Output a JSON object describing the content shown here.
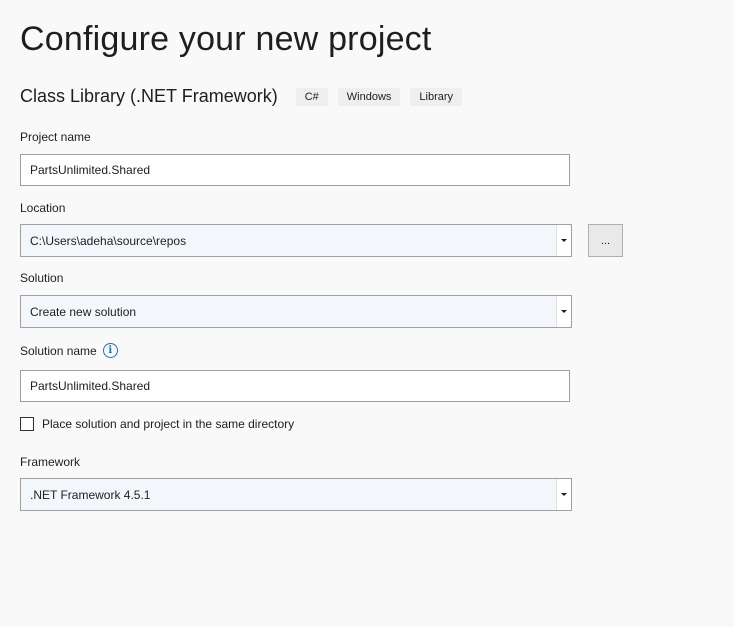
{
  "title": "Configure your new project",
  "template": {
    "name": "Class Library (.NET Framework)",
    "tags": [
      "C#",
      "Windows",
      "Library"
    ]
  },
  "project_name": {
    "label": "Project name",
    "value": "PartsUnlimited.Shared"
  },
  "location": {
    "label": "Location",
    "value": "C:\\Users\\adeha\\source\\repos",
    "browse_label": "..."
  },
  "solution": {
    "label": "Solution",
    "value": "Create new solution"
  },
  "solution_name": {
    "label": "Solution name",
    "value": "PartsUnlimited.Shared",
    "info_glyph": "i"
  },
  "same_directory": {
    "label": "Place solution and project in the same directory",
    "checked": false
  },
  "framework": {
    "label": "Framework",
    "value": ".NET Framework 4.5.1"
  },
  "icons": {
    "info": "info-icon",
    "dropdown": "chevron-down-icon",
    "checkbox": "checkbox-icon"
  },
  "colors": {
    "background": "#f9f9f9",
    "accent": "#1f6fb8",
    "border": "#a0a0a0"
  }
}
